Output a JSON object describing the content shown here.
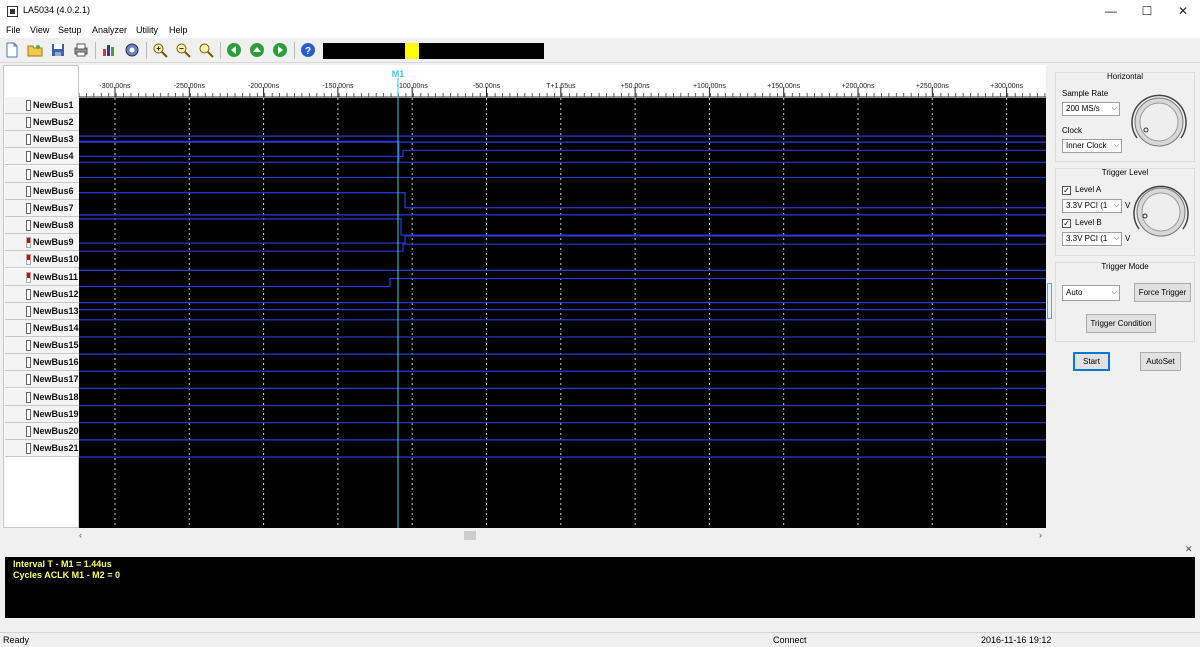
{
  "window": {
    "title": "LA5034 (4.0.2.1)",
    "minimize": "—",
    "maximize": "☐",
    "close": "✕"
  },
  "menu": [
    "File",
    "View",
    "Setup",
    "Analyzer",
    "Utility",
    "Help"
  ],
  "toolbar": {
    "icons": [
      "new-file-icon",
      "open-folder-icon",
      "save-icon",
      "print-icon",
      "bar-chart-icon",
      "settings-gear-icon",
      "zoom-in-icon",
      "zoom-out-icon",
      "zoom-fit-icon",
      "go-back-icon",
      "go-up-icon",
      "go-forward-icon",
      "help-icon"
    ],
    "overview_marker_color": "#ffff00"
  },
  "signals": [
    {
      "name": "NewBus1",
      "indicator": "gray"
    },
    {
      "name": "NewBus2",
      "indicator": "gray"
    },
    {
      "name": "NewBus3",
      "indicator": "gray"
    },
    {
      "name": "NewBus4",
      "indicator": "gray"
    },
    {
      "name": "NewBus5",
      "indicator": "gray"
    },
    {
      "name": "NewBus6",
      "indicator": "gray"
    },
    {
      "name": "NewBus7",
      "indicator": "gray"
    },
    {
      "name": "NewBus8",
      "indicator": "gray"
    },
    {
      "name": "NewBus9",
      "indicator": "red"
    },
    {
      "name": "NewBus10",
      "indicator": "red"
    },
    {
      "name": "NewBus11",
      "indicator": "red"
    },
    {
      "name": "NewBus12",
      "indicator": "gray"
    },
    {
      "name": "NewBus13",
      "indicator": "gray"
    },
    {
      "name": "NewBus14",
      "indicator": "gray"
    },
    {
      "name": "NewBus15",
      "indicator": "gray"
    },
    {
      "name": "NewBus16",
      "indicator": "gray"
    },
    {
      "name": "NewBus17",
      "indicator": "gray"
    },
    {
      "name": "NewBus18",
      "indicator": "gray"
    },
    {
      "name": "NewBus19",
      "indicator": "gray"
    },
    {
      "name": "NewBus20",
      "indicator": "gray"
    },
    {
      "name": "NewBus21",
      "indicator": "gray"
    }
  ],
  "timeline": {
    "ticks": [
      "-300.00ns",
      "-250.00ns",
      "-200.00ns",
      "-150.00ns",
      "-100.00ns",
      "-50.00ns",
      "T+1.65us",
      "+50.00ns",
      "+100.00ns",
      "+150.00ns",
      "+200.00ns",
      "+250.00ns",
      "+300.00ns"
    ],
    "marker_label": "M1",
    "marker_color": "#40c8d8",
    "trace_color": "#2a3ad8",
    "grid_color": "#d0d0d0"
  },
  "horizontal": {
    "title": "Horizontal",
    "sample_rate_label": "Sample Rate",
    "sample_rate_value": "200 MS/s",
    "clock_label": "Clock",
    "clock_value": "Inner Clock"
  },
  "trigger_level": {
    "title": "Trigger Level",
    "level_a_label": "Level A",
    "level_a_checked": true,
    "level_a_value": "3.3V PCI (1",
    "level_b_label": "Level B",
    "level_b_checked": true,
    "level_b_value": "3.3V PCI (1",
    "unit": "V"
  },
  "trigger_mode": {
    "title": "Trigger Mode",
    "mode_value": "Auto",
    "force_trigger_label": "Force Trigger",
    "trigger_condition_label": "Trigger Condition"
  },
  "actions": {
    "start_label": "Start",
    "autoset_label": "AutoSet"
  },
  "info": {
    "line1": "Interval  T - M1 = 1.44us",
    "line2": "Cycles  ACLK  M1 - M2 = 0",
    "text_color": "#ffff66"
  },
  "status": {
    "left": "Ready",
    "center": "Connect",
    "datetime": "2016-11-16  19:12"
  }
}
